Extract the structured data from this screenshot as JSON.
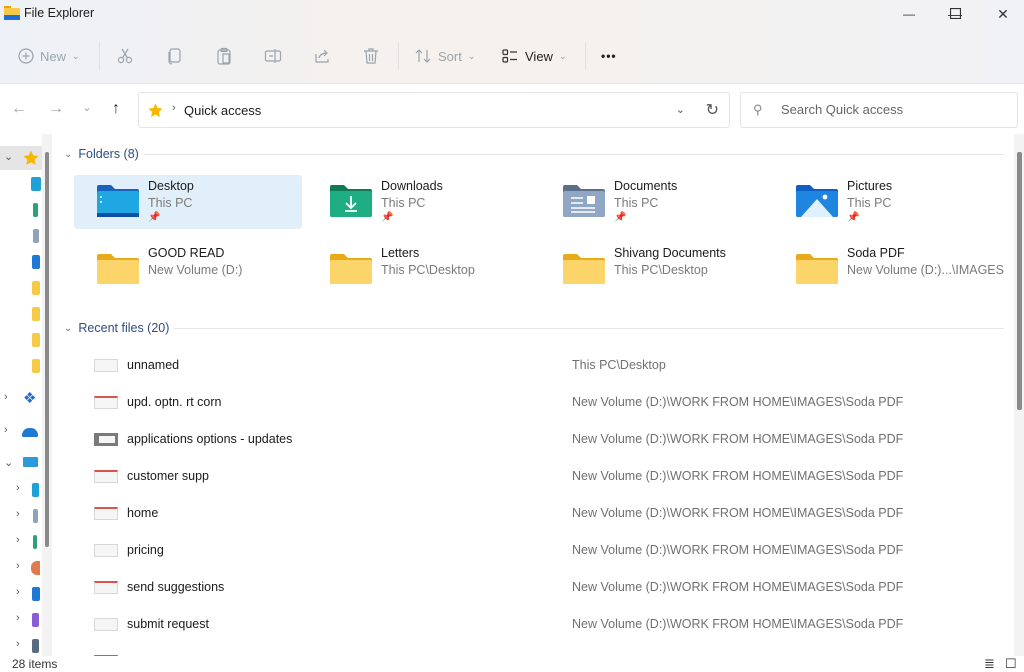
{
  "window": {
    "title": "File Explorer",
    "controls": {
      "minimize": "—",
      "maximize": "☐",
      "close": "✕"
    }
  },
  "toolbar": {
    "new_label": "New",
    "sort_label": "Sort",
    "view_label": "View",
    "more_label": "•••",
    "icons": [
      "plus-circle-icon",
      "cut-icon",
      "copy-icon",
      "paste-icon",
      "rename-icon",
      "share-icon",
      "delete-icon",
      "sort-icon",
      "view-icon",
      "more-icon"
    ]
  },
  "navigation": {
    "back": "←",
    "forward": "→",
    "recent": "⌄",
    "up": "↑",
    "breadcrumb": "Quick access",
    "search_placeholder": "Search Quick access"
  },
  "sections": {
    "folders_header": "Folders (8)",
    "recent_header": "Recent files (20)"
  },
  "folders": [
    {
      "name": "Desktop",
      "location": "This PC",
      "pinned": true,
      "icon": "desktop-folder-icon",
      "selected": true
    },
    {
      "name": "Downloads",
      "location": "This PC",
      "pinned": true,
      "icon": "downloads-folder-icon"
    },
    {
      "name": "Documents",
      "location": "This PC",
      "pinned": true,
      "icon": "documents-folder-icon"
    },
    {
      "name": "Pictures",
      "location": "This PC",
      "pinned": true,
      "icon": "pictures-folder-icon"
    },
    {
      "name": "GOOD READ",
      "location": "New Volume (D:)",
      "pinned": false,
      "icon": "folder-icon"
    },
    {
      "name": "Letters",
      "location": "This PC\\Desktop",
      "pinned": false,
      "icon": "folder-icon"
    },
    {
      "name": "Shivang Documents",
      "location": "This PC\\Desktop",
      "pinned": false,
      "icon": "folder-icon"
    },
    {
      "name": "Soda PDF",
      "location": "New Volume (D:)...\\IMAGES",
      "pinned": false,
      "icon": "folder-icon"
    }
  ],
  "recent_files": [
    {
      "name": "unnamed",
      "location": "This PC\\Desktop"
    },
    {
      "name": "upd. optn. rt corn",
      "location": "New Volume (D:)\\WORK FROM HOME\\IMAGES\\Soda PDF"
    },
    {
      "name": "applications options - updates",
      "location": "New Volume (D:)\\WORK FROM HOME\\IMAGES\\Soda PDF"
    },
    {
      "name": "customer supp",
      "location": "New Volume (D:)\\WORK FROM HOME\\IMAGES\\Soda PDF"
    },
    {
      "name": "home",
      "location": "New Volume (D:)\\WORK FROM HOME\\IMAGES\\Soda PDF"
    },
    {
      "name": "pricing",
      "location": "New Volume (D:)\\WORK FROM HOME\\IMAGES\\Soda PDF"
    },
    {
      "name": "send suggestions",
      "location": "New Volume (D:)\\WORK FROM HOME\\IMAGES\\Soda PDF"
    },
    {
      "name": "submit request",
      "location": "New Volume (D:)\\WORK FROM HOME\\IMAGES\\Soda PDF"
    }
  ],
  "status": {
    "item_count": "28 items",
    "details_view": "≣",
    "tiles_view": "☐"
  },
  "colors": {
    "accent": "#2e4d80",
    "selection": "#e1effb",
    "folder_yellow": "#f7c948",
    "star": "#f5b700"
  }
}
